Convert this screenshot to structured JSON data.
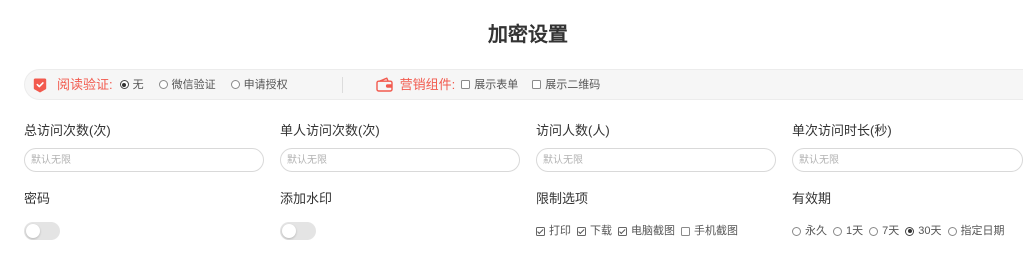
{
  "colors": {
    "accent": "#f25a4e",
    "text": "#333333",
    "option_text": "#555555",
    "placeholder": "#b3b3b3",
    "bar_background": "#f6f6f6",
    "toggle_off": "#e4e4e4"
  },
  "page": {
    "title": "加密设置"
  },
  "options_bar": {
    "read_verify": {
      "icon": "verify-badge-icon",
      "label": "阅读验证:",
      "options": [
        {
          "label": "无",
          "selected": true
        },
        {
          "label": "微信验证",
          "selected": false
        },
        {
          "label": "申请授权",
          "selected": false
        }
      ]
    },
    "marketing": {
      "icon": "wallet-icon",
      "label": "营销组件:",
      "options": [
        {
          "label": "展示表单",
          "checked": false
        },
        {
          "label": "展示二维码",
          "checked": false
        }
      ]
    }
  },
  "limits": [
    {
      "label": "总访问次数(次)",
      "placeholder": "默认无限",
      "value": ""
    },
    {
      "label": "单人访问次数(次)",
      "placeholder": "默认无限",
      "value": ""
    },
    {
      "label": "访问人数(人)",
      "placeholder": "默认无限",
      "value": ""
    },
    {
      "label": "单次访问时长(秒)",
      "placeholder": "默认无限",
      "value": ""
    }
  ],
  "password": {
    "label": "密码",
    "enabled": false
  },
  "watermark": {
    "label": "添加水印",
    "enabled": false
  },
  "restrictions": {
    "label": "限制选项",
    "options": [
      {
        "label": "打印",
        "checked": true
      },
      {
        "label": "下载",
        "checked": true
      },
      {
        "label": "电脑截图",
        "checked": true
      },
      {
        "label": "手机截图",
        "checked": false
      }
    ]
  },
  "validity": {
    "label": "有效期",
    "options": [
      {
        "label": "永久",
        "selected": false
      },
      {
        "label": "1天",
        "selected": false
      },
      {
        "label": "7天",
        "selected": false
      },
      {
        "label": "30天",
        "selected": true
      },
      {
        "label": "指定日期",
        "selected": false
      }
    ]
  }
}
